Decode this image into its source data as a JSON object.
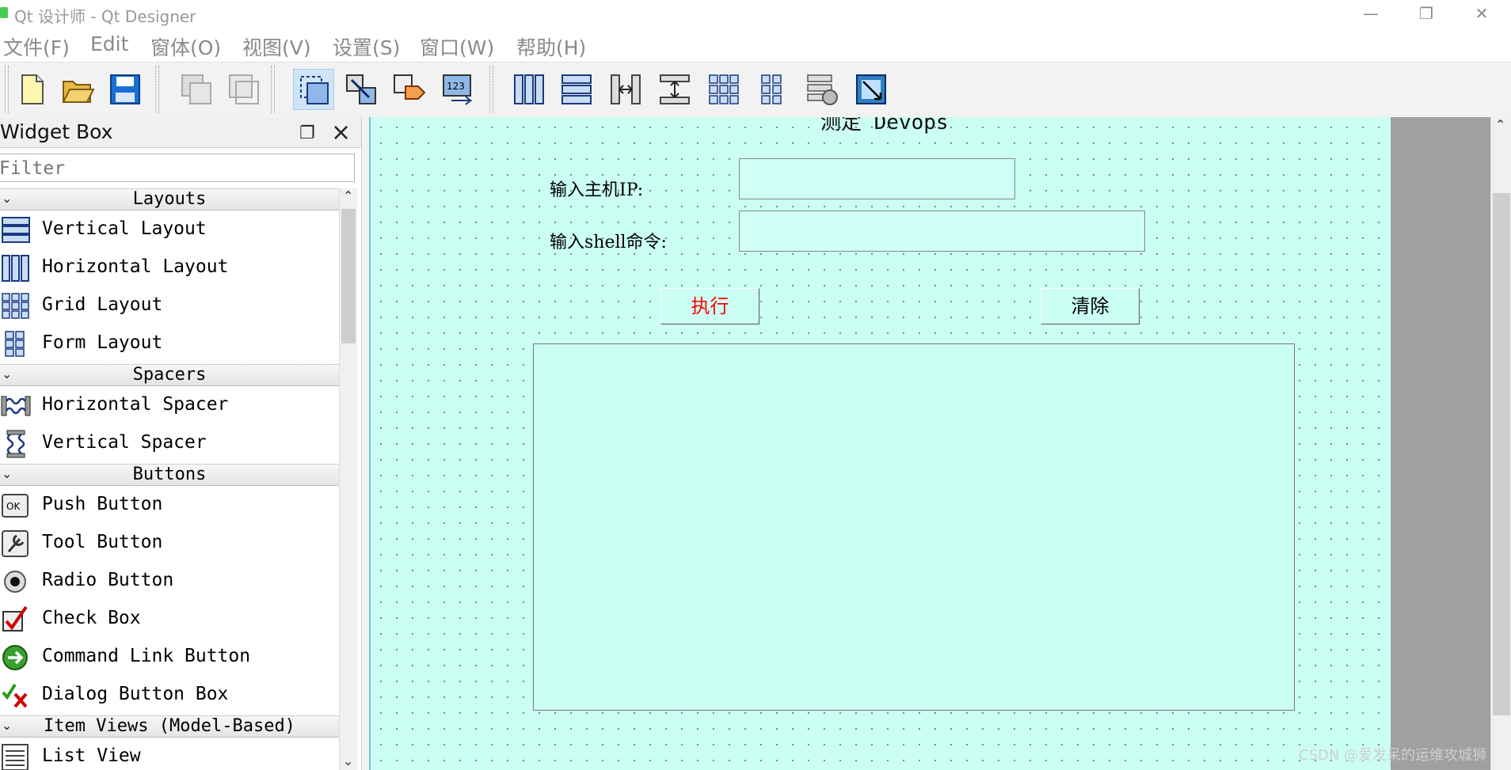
{
  "window": {
    "title": "Qt 设计师 - Qt Designer",
    "controls": [
      "—",
      "❐",
      "✕"
    ]
  },
  "menu": [
    "文件(F)",
    "Edit",
    "窗体(O)",
    "视图(V)",
    "设置(S)",
    "窗口(W)",
    "帮助(H)"
  ],
  "toolbar": {
    "file": [
      "new-file-icon",
      "open-folder-icon",
      "save-icon"
    ],
    "edit": [
      "copy-icon",
      "paste-icon"
    ],
    "mode": [
      "edit-widgets-icon",
      "edit-signals-slots-icon",
      "edit-buddies-icon",
      "edit-tab-order-icon"
    ],
    "layout": [
      "layout-horizontal-icon",
      "layout-vertical-icon",
      "layout-h-splitter-icon",
      "layout-v-splitter-icon",
      "layout-grid-icon",
      "layout-form-icon",
      "break-layout-icon",
      "adjust-size-icon"
    ]
  },
  "widget_box": {
    "title": "Widget Box",
    "filter_placeholder": "Filter",
    "categories": [
      {
        "label": "Layouts",
        "items": [
          {
            "label": "Vertical Layout",
            "icon": "vertical-layout-icon"
          },
          {
            "label": "Horizontal Layout",
            "icon": "horizontal-layout-icon"
          },
          {
            "label": "Grid Layout",
            "icon": "grid-layout-icon"
          },
          {
            "label": "Form Layout",
            "icon": "form-layout-icon"
          }
        ]
      },
      {
        "label": "Spacers",
        "items": [
          {
            "label": "Horizontal Spacer",
            "icon": "horizontal-spacer-icon"
          },
          {
            "label": "Vertical Spacer",
            "icon": "vertical-spacer-icon"
          }
        ]
      },
      {
        "label": "Buttons",
        "items": [
          {
            "label": "Push Button",
            "icon": "push-button-icon"
          },
          {
            "label": "Tool Button",
            "icon": "tool-button-icon"
          },
          {
            "label": "Radio Button",
            "icon": "radio-button-icon"
          },
          {
            "label": "Check Box",
            "icon": "check-box-icon"
          },
          {
            "label": "Command Link Button",
            "icon": "command-link-icon"
          },
          {
            "label": "Dialog Button Box",
            "icon": "dialog-button-box-icon"
          }
        ]
      },
      {
        "label": "Item Views (Model-Based)",
        "items": [
          {
            "label": "List View",
            "icon": "list-view-icon"
          }
        ]
      }
    ]
  },
  "form": {
    "partial_title": "测定 Devops",
    "host_label": "输入主机IP:",
    "host_value": "",
    "cmd_label": "输入shell命令:",
    "cmd_value": "",
    "execute_button": "执行",
    "clear_button": "清除",
    "output_value": "",
    "background_color": "#ccfff4",
    "execute_color": "#ff0000"
  },
  "watermark": "CSDN @爱发呆的运维攻城狮"
}
